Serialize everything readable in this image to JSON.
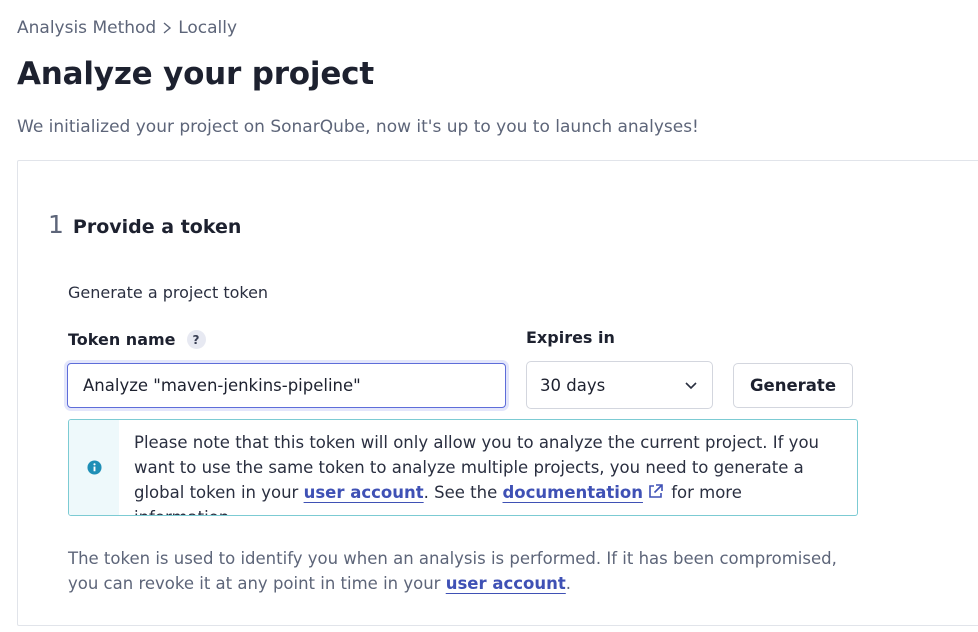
{
  "breadcrumb": {
    "items": [
      "Analysis Method",
      "Locally"
    ]
  },
  "page": {
    "title": "Analyze your project",
    "subtitle": "We initialized your project on SonarQube, now it's up to you to launch analyses!"
  },
  "step": {
    "number": "1",
    "title": "Provide a token",
    "section_label": "Generate a project token",
    "token_name_label": "Token name",
    "help_glyph": "?",
    "token_name_value": "Analyze \"maven-jenkins-pipeline\"",
    "expires_label": "Expires in",
    "expires_value": "30 days",
    "generate_label": "Generate"
  },
  "info": {
    "text_1": "Please note that this token will only allow you to analyze the current project. If you want to use the same token to analyze multiple projects, you need to generate a global token in your ",
    "link_user_account": "user account",
    "text_2": ". See the ",
    "link_documentation": "documentation",
    "text_3": " for more information."
  },
  "footer": {
    "text_1": "The token is used to identify you when an analysis is performed. If it has been compromised, you can revoke it at any point in time in your ",
    "link_user_account": "user account",
    "text_2": "."
  },
  "icons": {
    "breadcrumb_separator": "chevron-right-icon",
    "help": "question-icon",
    "select_arrow": "chevron-down-icon",
    "info": "info-icon",
    "external_link": "external-link-icon"
  },
  "colors": {
    "link": "#3f51b5",
    "input_focus": "#5e6dd9",
    "info_border": "#7ccbd3",
    "info_icon": "#1e8fb6"
  }
}
